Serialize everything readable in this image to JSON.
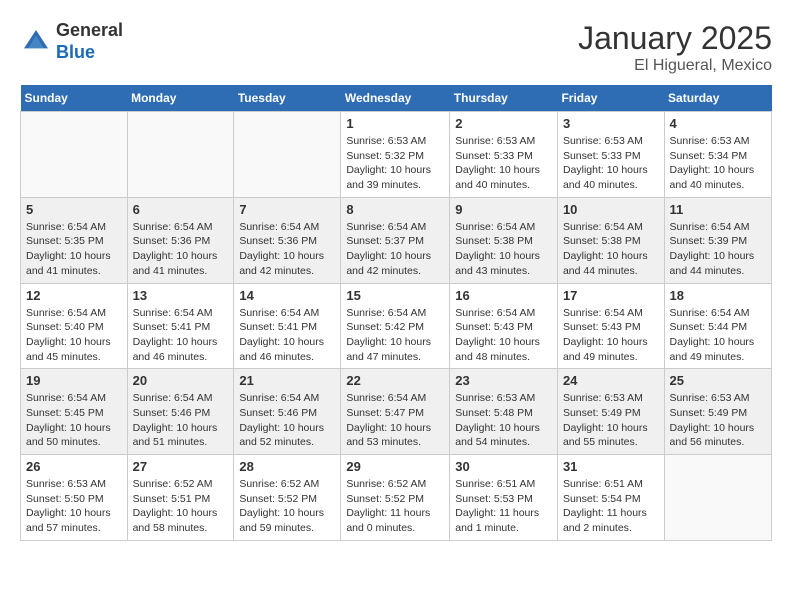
{
  "header": {
    "logo_general": "General",
    "logo_blue": "Blue",
    "title": "January 2025",
    "subtitle": "El Higueral, Mexico"
  },
  "weekdays": [
    "Sunday",
    "Monday",
    "Tuesday",
    "Wednesday",
    "Thursday",
    "Friday",
    "Saturday"
  ],
  "weeks": [
    [
      {
        "num": "",
        "info": ""
      },
      {
        "num": "",
        "info": ""
      },
      {
        "num": "",
        "info": ""
      },
      {
        "num": "1",
        "info": "Sunrise: 6:53 AM\nSunset: 5:32 PM\nDaylight: 10 hours\nand 39 minutes."
      },
      {
        "num": "2",
        "info": "Sunrise: 6:53 AM\nSunset: 5:33 PM\nDaylight: 10 hours\nand 40 minutes."
      },
      {
        "num": "3",
        "info": "Sunrise: 6:53 AM\nSunset: 5:33 PM\nDaylight: 10 hours\nand 40 minutes."
      },
      {
        "num": "4",
        "info": "Sunrise: 6:53 AM\nSunset: 5:34 PM\nDaylight: 10 hours\nand 40 minutes."
      }
    ],
    [
      {
        "num": "5",
        "info": "Sunrise: 6:54 AM\nSunset: 5:35 PM\nDaylight: 10 hours\nand 41 minutes."
      },
      {
        "num": "6",
        "info": "Sunrise: 6:54 AM\nSunset: 5:36 PM\nDaylight: 10 hours\nand 41 minutes."
      },
      {
        "num": "7",
        "info": "Sunrise: 6:54 AM\nSunset: 5:36 PM\nDaylight: 10 hours\nand 42 minutes."
      },
      {
        "num": "8",
        "info": "Sunrise: 6:54 AM\nSunset: 5:37 PM\nDaylight: 10 hours\nand 42 minutes."
      },
      {
        "num": "9",
        "info": "Sunrise: 6:54 AM\nSunset: 5:38 PM\nDaylight: 10 hours\nand 43 minutes."
      },
      {
        "num": "10",
        "info": "Sunrise: 6:54 AM\nSunset: 5:38 PM\nDaylight: 10 hours\nand 44 minutes."
      },
      {
        "num": "11",
        "info": "Sunrise: 6:54 AM\nSunset: 5:39 PM\nDaylight: 10 hours\nand 44 minutes."
      }
    ],
    [
      {
        "num": "12",
        "info": "Sunrise: 6:54 AM\nSunset: 5:40 PM\nDaylight: 10 hours\nand 45 minutes."
      },
      {
        "num": "13",
        "info": "Sunrise: 6:54 AM\nSunset: 5:41 PM\nDaylight: 10 hours\nand 46 minutes."
      },
      {
        "num": "14",
        "info": "Sunrise: 6:54 AM\nSunset: 5:41 PM\nDaylight: 10 hours\nand 46 minutes."
      },
      {
        "num": "15",
        "info": "Sunrise: 6:54 AM\nSunset: 5:42 PM\nDaylight: 10 hours\nand 47 minutes."
      },
      {
        "num": "16",
        "info": "Sunrise: 6:54 AM\nSunset: 5:43 PM\nDaylight: 10 hours\nand 48 minutes."
      },
      {
        "num": "17",
        "info": "Sunrise: 6:54 AM\nSunset: 5:43 PM\nDaylight: 10 hours\nand 49 minutes."
      },
      {
        "num": "18",
        "info": "Sunrise: 6:54 AM\nSunset: 5:44 PM\nDaylight: 10 hours\nand 49 minutes."
      }
    ],
    [
      {
        "num": "19",
        "info": "Sunrise: 6:54 AM\nSunset: 5:45 PM\nDaylight: 10 hours\nand 50 minutes."
      },
      {
        "num": "20",
        "info": "Sunrise: 6:54 AM\nSunset: 5:46 PM\nDaylight: 10 hours\nand 51 minutes."
      },
      {
        "num": "21",
        "info": "Sunrise: 6:54 AM\nSunset: 5:46 PM\nDaylight: 10 hours\nand 52 minutes."
      },
      {
        "num": "22",
        "info": "Sunrise: 6:54 AM\nSunset: 5:47 PM\nDaylight: 10 hours\nand 53 minutes."
      },
      {
        "num": "23",
        "info": "Sunrise: 6:53 AM\nSunset: 5:48 PM\nDaylight: 10 hours\nand 54 minutes."
      },
      {
        "num": "24",
        "info": "Sunrise: 6:53 AM\nSunset: 5:49 PM\nDaylight: 10 hours\nand 55 minutes."
      },
      {
        "num": "25",
        "info": "Sunrise: 6:53 AM\nSunset: 5:49 PM\nDaylight: 10 hours\nand 56 minutes."
      }
    ],
    [
      {
        "num": "26",
        "info": "Sunrise: 6:53 AM\nSunset: 5:50 PM\nDaylight: 10 hours\nand 57 minutes."
      },
      {
        "num": "27",
        "info": "Sunrise: 6:52 AM\nSunset: 5:51 PM\nDaylight: 10 hours\nand 58 minutes."
      },
      {
        "num": "28",
        "info": "Sunrise: 6:52 AM\nSunset: 5:52 PM\nDaylight: 10 hours\nand 59 minutes."
      },
      {
        "num": "29",
        "info": "Sunrise: 6:52 AM\nSunset: 5:52 PM\nDaylight: 11 hours\nand 0 minutes."
      },
      {
        "num": "30",
        "info": "Sunrise: 6:51 AM\nSunset: 5:53 PM\nDaylight: 11 hours\nand 1 minute."
      },
      {
        "num": "31",
        "info": "Sunrise: 6:51 AM\nSunset: 5:54 PM\nDaylight: 11 hours\nand 2 minutes."
      },
      {
        "num": "",
        "info": ""
      }
    ]
  ]
}
